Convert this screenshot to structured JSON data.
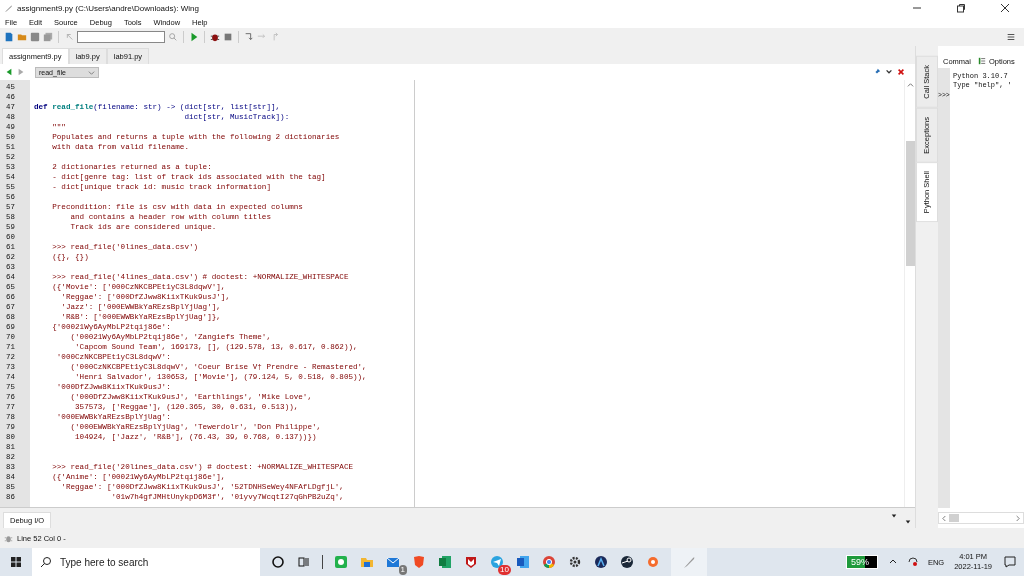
{
  "window": {
    "title": "assignment9.py (C:\\Users\\andre\\Downloads): Wing"
  },
  "menu": [
    "File",
    "Edit",
    "Source",
    "Debug",
    "Tools",
    "Window",
    "Help"
  ],
  "tabs": [
    {
      "label": "assignment9.py",
      "selected": true
    },
    {
      "label": "lab9.py",
      "selected": false
    },
    {
      "label": "lab91.py",
      "selected": false
    }
  ],
  "scope_dropdown": {
    "value": "read_file"
  },
  "code": [
    {
      "n": "45"
    },
    {
      "n": "46"
    },
    {
      "n": "47",
      "segs": [
        {
          "kind": "kw",
          "text": "def "
        },
        {
          "kind": "fn",
          "text": "read_file"
        },
        {
          "kind": "op",
          "text": "(filename: str) -> (dict[str, list[str]],"
        }
      ]
    },
    {
      "n": "48",
      "segs": [
        {
          "kind": "op",
          "text": "                                 dict[str, MusicTrack]):"
        }
      ]
    },
    {
      "n": "49",
      "segs": [
        {
          "kind": "doc",
          "text": "    \"\"\""
        }
      ]
    },
    {
      "n": "50",
      "segs": [
        {
          "kind": "doc",
          "text": "    Populates and returns a tuple with the following 2 dictionaries"
        }
      ]
    },
    {
      "n": "51",
      "segs": [
        {
          "kind": "doc",
          "text": "    with data from valid filename."
        }
      ]
    },
    {
      "n": "52"
    },
    {
      "n": "53",
      "segs": [
        {
          "kind": "doc",
          "text": "    2 dictionaries returned as a tuple:"
        }
      ]
    },
    {
      "n": "54",
      "segs": [
        {
          "kind": "doc",
          "text": "    - dict[genre tag: list of track ids associated with the tag]"
        }
      ]
    },
    {
      "n": "55",
      "segs": [
        {
          "kind": "doc",
          "text": "    - dict[unique track id: music track information]"
        }
      ]
    },
    {
      "n": "56"
    },
    {
      "n": "57",
      "segs": [
        {
          "kind": "doc",
          "text": "    Precondition: file is csv with data in expected columns"
        }
      ]
    },
    {
      "n": "58",
      "segs": [
        {
          "kind": "doc",
          "text": "        and contains a header row with column titles"
        }
      ]
    },
    {
      "n": "59",
      "segs": [
        {
          "kind": "doc",
          "text": "        Track ids are considered unique."
        }
      ]
    },
    {
      "n": "60"
    },
    {
      "n": "61",
      "segs": [
        {
          "kind": "doc",
          "text": "    >>> read_file('0lines_data.csv')"
        }
      ]
    },
    {
      "n": "62",
      "segs": [
        {
          "kind": "doc",
          "text": "    ({}, {})"
        }
      ]
    },
    {
      "n": "63"
    },
    {
      "n": "64",
      "segs": [
        {
          "kind": "doc",
          "text": "    >>> read_file('4lines_data.csv') # doctest: +NORMALIZE_WHITESPACE"
        }
      ]
    },
    {
      "n": "65",
      "segs": [
        {
          "kind": "doc",
          "text": "    ({'Movie': ['000CzNKCBPEt1yC3L8dqwV'],"
        }
      ]
    },
    {
      "n": "66",
      "segs": [
        {
          "kind": "doc",
          "text": "      'Reggae': ['000DfZJww8KiixTKuk9usJ'],"
        }
      ]
    },
    {
      "n": "67",
      "segs": [
        {
          "kind": "doc",
          "text": "      'Jazz': ['000EWWBkYaREzsBplYjUag'],"
        }
      ]
    },
    {
      "n": "68",
      "segs": [
        {
          "kind": "doc",
          "text": "      'R&B': ['000EWWBkYaREzsBplYjUag']},"
        }
      ]
    },
    {
      "n": "69",
      "segs": [
        {
          "kind": "doc",
          "text": "    {'00021Wy6AyMbLP2tqij86e':"
        }
      ]
    },
    {
      "n": "70",
      "segs": [
        {
          "kind": "doc",
          "text": "        ('00021Wy6AyMbLP2tqij86e', 'Zangiefs Theme',"
        }
      ]
    },
    {
      "n": "71",
      "segs": [
        {
          "kind": "doc",
          "text": "         'Capcom Sound Team', 169173, [], (129.578, 13, 0.617, 0.862)),"
        }
      ]
    },
    {
      "n": "72",
      "segs": [
        {
          "kind": "doc",
          "text": "     '000CzNKCBPEt1yC3L8dqwV':"
        }
      ]
    },
    {
      "n": "73",
      "segs": [
        {
          "kind": "doc",
          "text": "        ('000CzNKCBPEt1yC3L8dqwV', 'Coeur Brise V† Prendre - Remastered',"
        }
      ]
    },
    {
      "n": "74",
      "segs": [
        {
          "kind": "doc",
          "text": "         'Henri Salvador', 130653, ['Movie'], (79.124, 5, 0.518, 0.805)),"
        }
      ]
    },
    {
      "n": "75",
      "segs": [
        {
          "kind": "doc",
          "text": "     '000DfZJww8KiixTKuk9usJ':"
        }
      ]
    },
    {
      "n": "76",
      "segs": [
        {
          "kind": "doc",
          "text": "        ('000DfZJww8KiixTKuk9usJ', 'Earthlings', 'Mike Love',"
        }
      ]
    },
    {
      "n": "77",
      "segs": [
        {
          "kind": "doc",
          "text": "         357573, ['Reggae'], (120.365, 30, 0.631, 0.513)),"
        }
      ]
    },
    {
      "n": "78",
      "segs": [
        {
          "kind": "doc",
          "text": "     '000EWWBkYaREzsBplYjUag':"
        }
      ]
    },
    {
      "n": "79",
      "segs": [
        {
          "kind": "doc",
          "text": "        ('000EWWBkYaREzsBplYjUag', 'Tewerdolr', 'Don Philippe',"
        }
      ]
    },
    {
      "n": "80",
      "segs": [
        {
          "kind": "doc",
          "text": "         104924, ['Jazz', 'R&B'], (76.43, 39, 0.768, 0.137))})"
        }
      ]
    },
    {
      "n": "81"
    },
    {
      "n": "82"
    },
    {
      "n": "83",
      "segs": [
        {
          "kind": "doc",
          "text": "    >>> read_file('20lines_data.csv') # doctest: +NORMALIZE_WHITESPACE"
        }
      ]
    },
    {
      "n": "84",
      "segs": [
        {
          "kind": "doc",
          "text": "    ({'Anime': ['00021Wy6AyMbLP2tqij86e'],"
        }
      ]
    },
    {
      "n": "85",
      "segs": [
        {
          "kind": "doc",
          "text": "      'Reggae': ['000DfZJww8KiixTKuk9usJ', '52TDNHSeWey4NFAfLDgfjL',"
        }
      ]
    },
    {
      "n": "86",
      "segs": [
        {
          "kind": "doc",
          "text": "                 '01w7h4gfJMHtUnykpD6M3f', '01yvy7WcqtI27qGhPB2uZq',"
        }
      ]
    }
  ],
  "side_tabs": [
    {
      "label": "Call Stack",
      "selected": false
    },
    {
      "label": "Exceptions",
      "selected": false
    },
    {
      "label": "Python Shell",
      "selected": true
    }
  ],
  "shell": {
    "header": "Commai",
    "options": "Options",
    "prompt": ">>>",
    "lines": [
      "Python 3.10.7",
      "Type \"help\", '"
    ]
  },
  "bottom_tabs": [
    {
      "label": "Debug I/O",
      "selected": true
    }
  ],
  "status": "Line 52 Col 0 -",
  "taskbar": {
    "search_placeholder": "Type here to search",
    "mail_badge": "1",
    "messenger_badge": "10",
    "battery": "59%",
    "language": "ENG",
    "time": "4:01 PM",
    "date": "2022-11-19"
  }
}
